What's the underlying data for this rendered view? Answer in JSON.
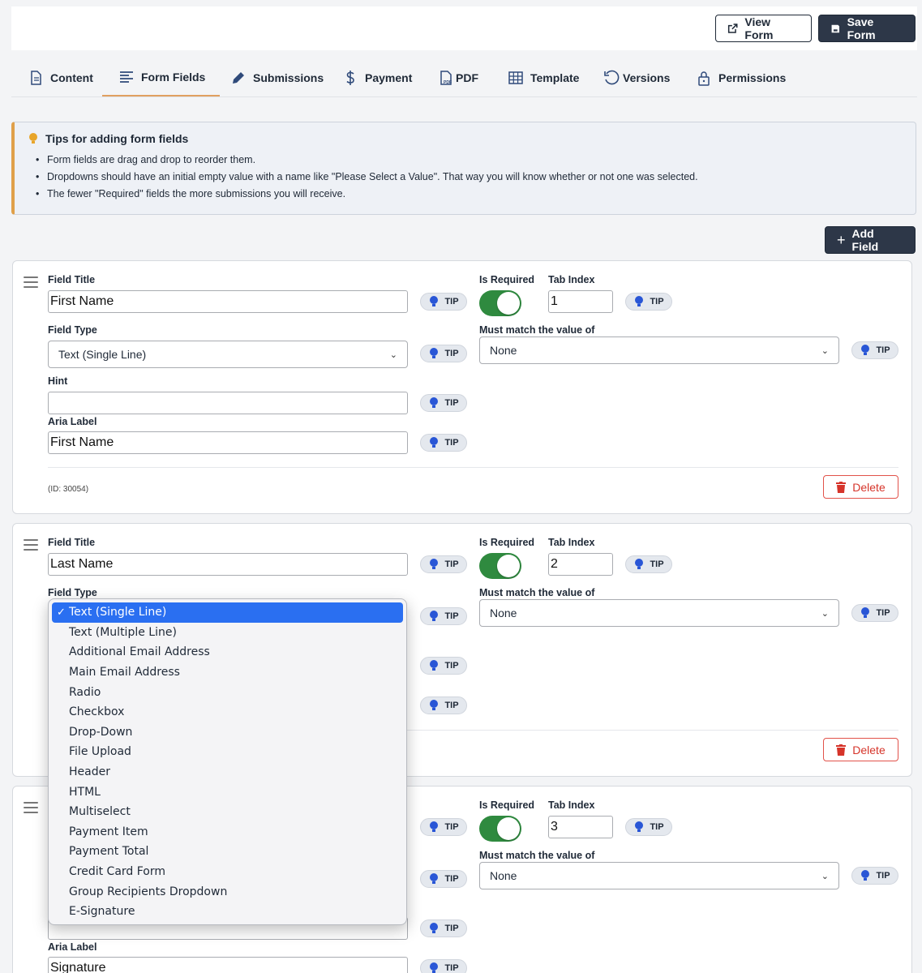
{
  "toolbar": {
    "view_form": "View Form",
    "save_form": "Save Form",
    "add_field": "Add Field"
  },
  "tabs": [
    {
      "label": "Content",
      "icon": "document-icon"
    },
    {
      "label": "Form Fields",
      "icon": "list-icon",
      "active": true
    },
    {
      "label": "Submissions",
      "icon": "pencil-icon"
    },
    {
      "label": "Payment",
      "icon": "dollar-icon"
    },
    {
      "label": "PDF",
      "icon": "pdf-icon"
    },
    {
      "label": "Template",
      "icon": "grid-icon"
    },
    {
      "label": "Versions",
      "icon": "history-icon"
    },
    {
      "label": "Permissions",
      "icon": "lock-icon"
    }
  ],
  "tips": {
    "title": "Tips for adding form fields",
    "items": [
      "Form fields are drag and drop to reorder them.",
      "Dropdowns should have an initial empty value with a name like \"Please Select a Value\". That way you will know whether or not one was selected.",
      "The fewer \"Required\" fields the more submissions you will receive."
    ]
  },
  "labels": {
    "field_title": "Field Title",
    "field_type": "Field Type",
    "hint": "Hint",
    "aria_label": "Aria Label",
    "is_required": "Is Required",
    "tab_index": "Tab Index",
    "must_match": "Must match the value of",
    "tip": "TIP",
    "delete": "Delete"
  },
  "fields": [
    {
      "title": "First Name",
      "type": "Text (Single Line)",
      "hint": "",
      "aria_label": "First Name",
      "required": true,
      "tab_index": "1",
      "must_match": "None",
      "id_text": "(ID: 30054)"
    },
    {
      "title": "Last Name",
      "type": "Text (Single Line)",
      "required": true,
      "tab_index": "2",
      "must_match": "None"
    },
    {
      "required": true,
      "tab_index": "3",
      "must_match": "None",
      "aria_label": "Signature"
    }
  ],
  "field_type_options": [
    "Text (Single Line)",
    "Text (Multiple Line)",
    "Additional Email Address",
    "Main Email Address",
    "Radio",
    "Checkbox",
    "Drop-Down",
    "File Upload",
    "Header",
    "HTML",
    "Multiselect",
    "Payment Item",
    "Payment Total",
    "Credit Card Form",
    "Group Recipients Dropdown",
    "E-Signature"
  ],
  "colors": {
    "accent_tab": "#e0a060",
    "toggle_on": "#2f8a3f",
    "delete_red": "#d6342a",
    "dark_button": "#2d3748",
    "selected_option": "#2a6ff1"
  }
}
